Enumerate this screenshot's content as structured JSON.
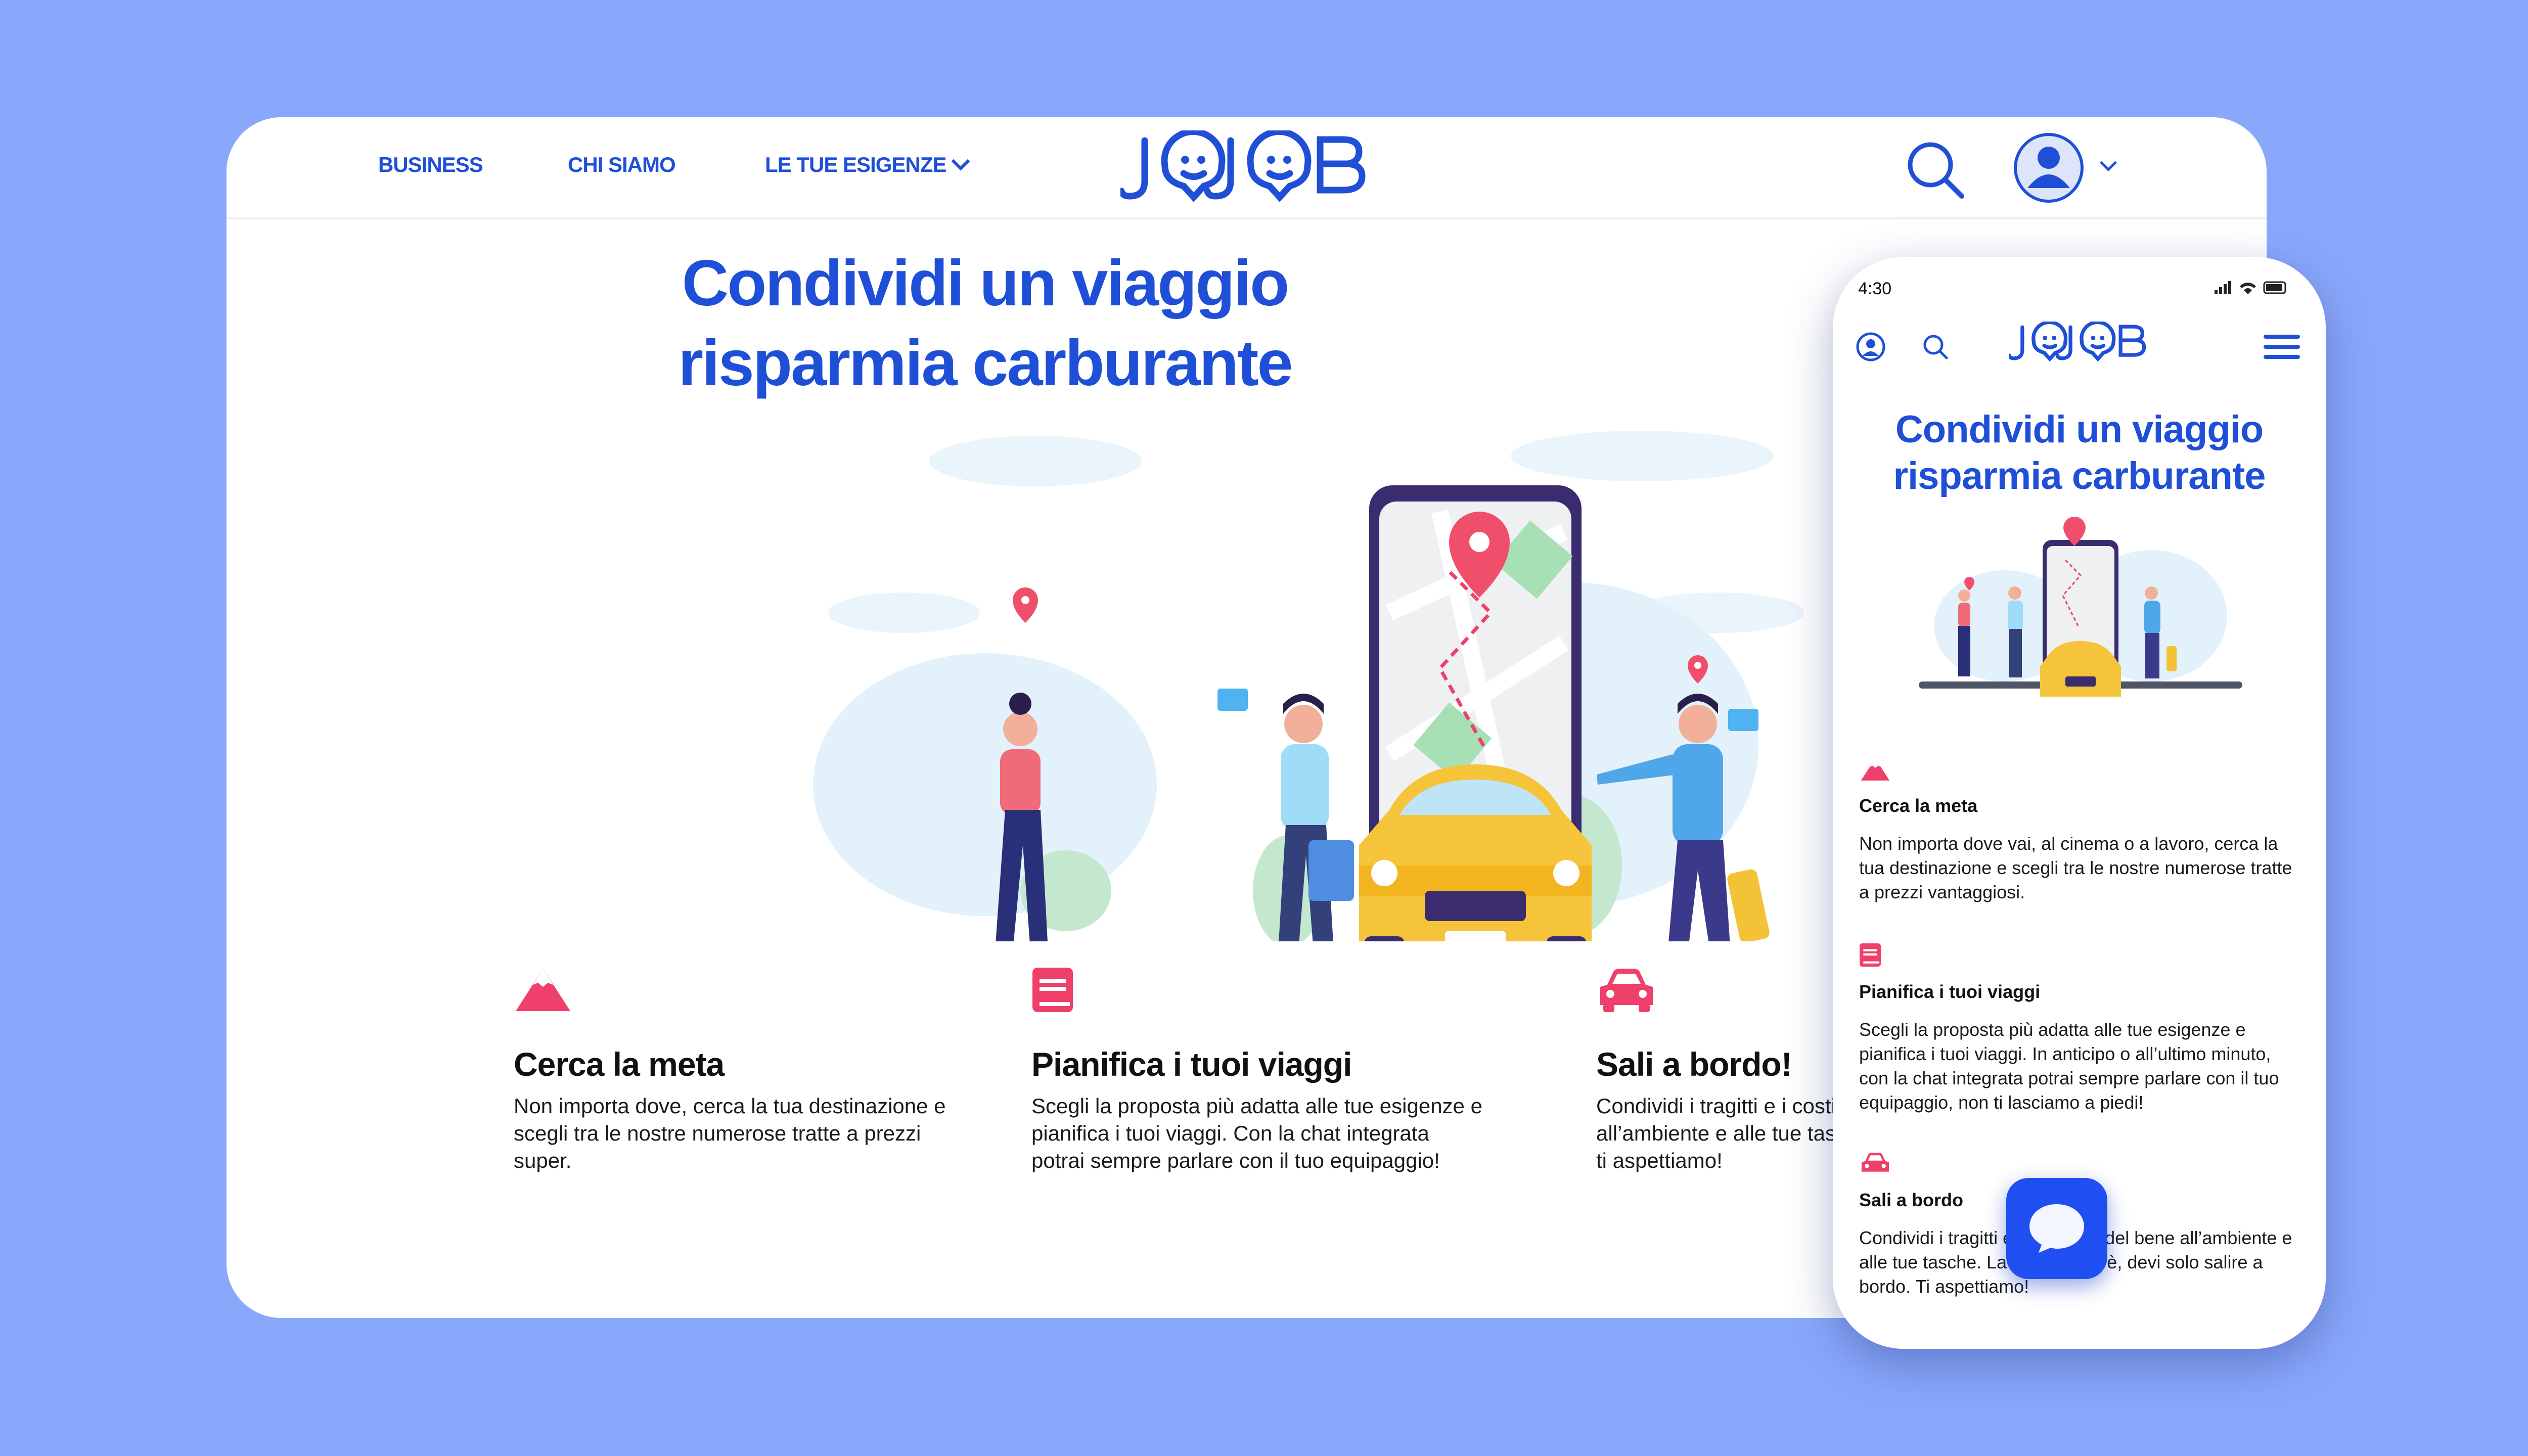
{
  "brand": {
    "logo": "JOJOB",
    "primary_color": "#1f4fd6",
    "accent_color": "#ef3f6b",
    "background": "#8aa8fb"
  },
  "desktop": {
    "nav": {
      "links": [
        "BUSINESS",
        "CHI SIAMO",
        "LE TUE ESIGENZE"
      ],
      "icons": [
        "search-icon",
        "user-avatar-icon",
        "chevron-down-icon"
      ]
    },
    "hero": {
      "line1": "Condividi un viaggio",
      "line2": "risparmia carburante"
    },
    "features": [
      {
        "icon": "mountain-icon",
        "title": "Cerca la meta",
        "text": "Non importa dove, cerca la tua destinazione e scegli tra le nostre numerose tratte a prezzi super."
      },
      {
        "icon": "book-icon",
        "title": "Pianifica i tuoi viaggi",
        "text": "Scegli la proposta più adatta alle tue esigenze e pianifica i tuoi viaggi. Con la chat integrata potrai sempre parlare con il tuo equipaggio!"
      },
      {
        "icon": "car-icon",
        "title": "Sali a bordo!",
        "text": "Condividi i tragitti e i costi. Fai del bene all’ambiente e alle tue tasche. La soluzione c’è, ti aspettiamo!"
      }
    ]
  },
  "mobile": {
    "status": {
      "time": "4:30"
    },
    "hero": {
      "line1": "Condividi un viaggio",
      "line2": "risparmia carburante"
    },
    "features": [
      {
        "icon": "mountain-icon",
        "title": "Cerca la meta",
        "text": "Non importa dove vai, al cinema o a lavoro, cerca la tua destinazione e scegli tra le nostre numerose tratte a prezzi vantaggiosi."
      },
      {
        "icon": "book-icon",
        "title": "Pianifica i tuoi viaggi",
        "text": "Scegli la proposta più adatta alle tue esigenze e pianifica i tuoi viaggi. In anticipo o all’ultimo minuto, con la chat integrata potrai sempre parlare con il tuo equipaggio, non ti lasciamo a piedi!"
      },
      {
        "icon": "car-icon",
        "title": "Sali a bordo",
        "text": "Condividi i tragitti e i costi. Fai del bene all’ambiente e alle tue tasche. La soluzione c’è, devi solo salire a bordo. Ti aspettiamo!"
      }
    ]
  }
}
